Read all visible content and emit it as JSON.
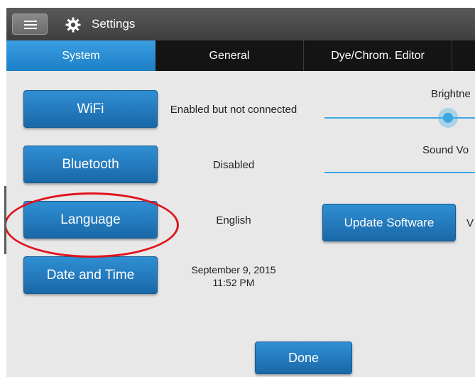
{
  "header": {
    "title": "Settings",
    "menu_icon": "hamburger-menu-icon",
    "settings_icon": "gear-icon"
  },
  "tabs": [
    {
      "label": "System",
      "active": true
    },
    {
      "label": "General",
      "active": false
    },
    {
      "label": "Dye/Chrom. Editor",
      "active": false
    }
  ],
  "system": {
    "wifi": {
      "button": "WiFi",
      "status": "Enabled but not connected"
    },
    "bluetooth": {
      "button": "Bluetooth",
      "status": "Disabled"
    },
    "language": {
      "button": "Language",
      "status": "English"
    },
    "datetime": {
      "button": "Date and Time",
      "date": "September 9, 2015",
      "time": "11:52 PM"
    },
    "brightness": {
      "label": "Brightne"
    },
    "sound": {
      "label": "Sound Vo"
    },
    "update": {
      "button": "Update Software",
      "status": "V"
    }
  },
  "footer": {
    "done": "Done"
  },
  "colors": {
    "accent": "#1d7fc6",
    "annotation": "#e0141c"
  }
}
